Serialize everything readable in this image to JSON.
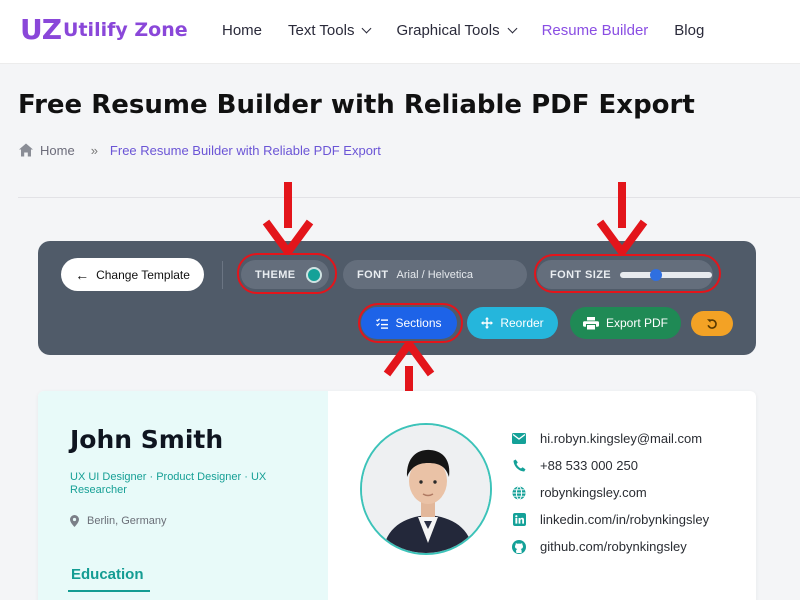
{
  "header": {
    "logo_mark": "UZ",
    "logo_text": "Utilify Zone",
    "nav": [
      {
        "label": "Home"
      },
      {
        "label": "Text Tools"
      },
      {
        "label": "Graphical Tools"
      },
      {
        "label": "Resume Builder"
      },
      {
        "label": "Blog"
      }
    ]
  },
  "page": {
    "title": "Free Resume Builder with Reliable PDF Export",
    "breadcrumb": {
      "home": "Home",
      "separator": "»",
      "current": "Free Resume Builder with Reliable PDF Export"
    }
  },
  "toolbar": {
    "change_template": "Change Template",
    "theme_label": "THEME",
    "theme_color": "#14a198",
    "font_label": "FONT",
    "font_value": "Arial / Helvetica",
    "font_size_label": "FONT SIZE",
    "font_size_level": 0.38,
    "sections": "Sections",
    "reorder": "Reorder",
    "export_pdf": "Export PDF"
  },
  "resume": {
    "name": "John Smith",
    "role": "UX UI Designer · Product Designer · UX Researcher",
    "location": "Berlin, Germany",
    "section_heading": "Education",
    "contacts": {
      "email": "hi.robyn.kingsley@mail.com",
      "phone": "+88 533 000 250",
      "website": "robynkingsley.com",
      "linkedin": "linkedin.com/in/robynkingsley",
      "github": "github.com/robynkingsley"
    }
  },
  "colors": {
    "brand": "#8a47d9",
    "accent_teal": "#149c93",
    "toolbar_bg": "#505b69",
    "sections_btn": "#1d63e8",
    "reorder_btn": "#25b6dc",
    "export_btn": "#1f8a55",
    "undo_btn": "#f3a225",
    "annotation_red": "#e3151b"
  }
}
